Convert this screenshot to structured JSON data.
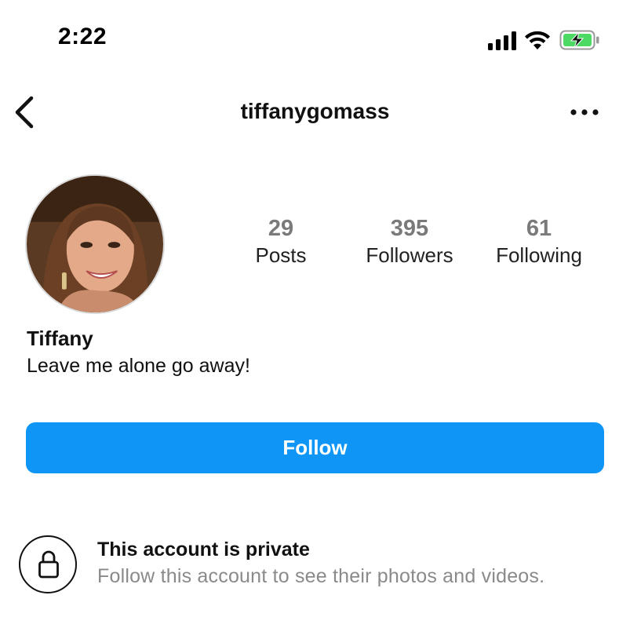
{
  "status_bar": {
    "time": "2:22",
    "battery_color": "#4cd964"
  },
  "header": {
    "username": "tiffanygomass",
    "back_icon": "chevron-left-icon",
    "more_icon": "more-horizontal-icon"
  },
  "profile": {
    "stats": [
      {
        "value": "29",
        "label": "Posts"
      },
      {
        "value": "395",
        "label": "Followers"
      },
      {
        "value": "61",
        "label": "Following"
      }
    ],
    "display_name": "Tiffany",
    "bio": "Leave me alone go away!"
  },
  "actions": {
    "follow_label": "Follow",
    "follow_color": "#0e95f6"
  },
  "private_notice": {
    "title": "This account is private",
    "subtitle": "Follow this account to see their photos and videos.",
    "icon": "lock-icon"
  }
}
